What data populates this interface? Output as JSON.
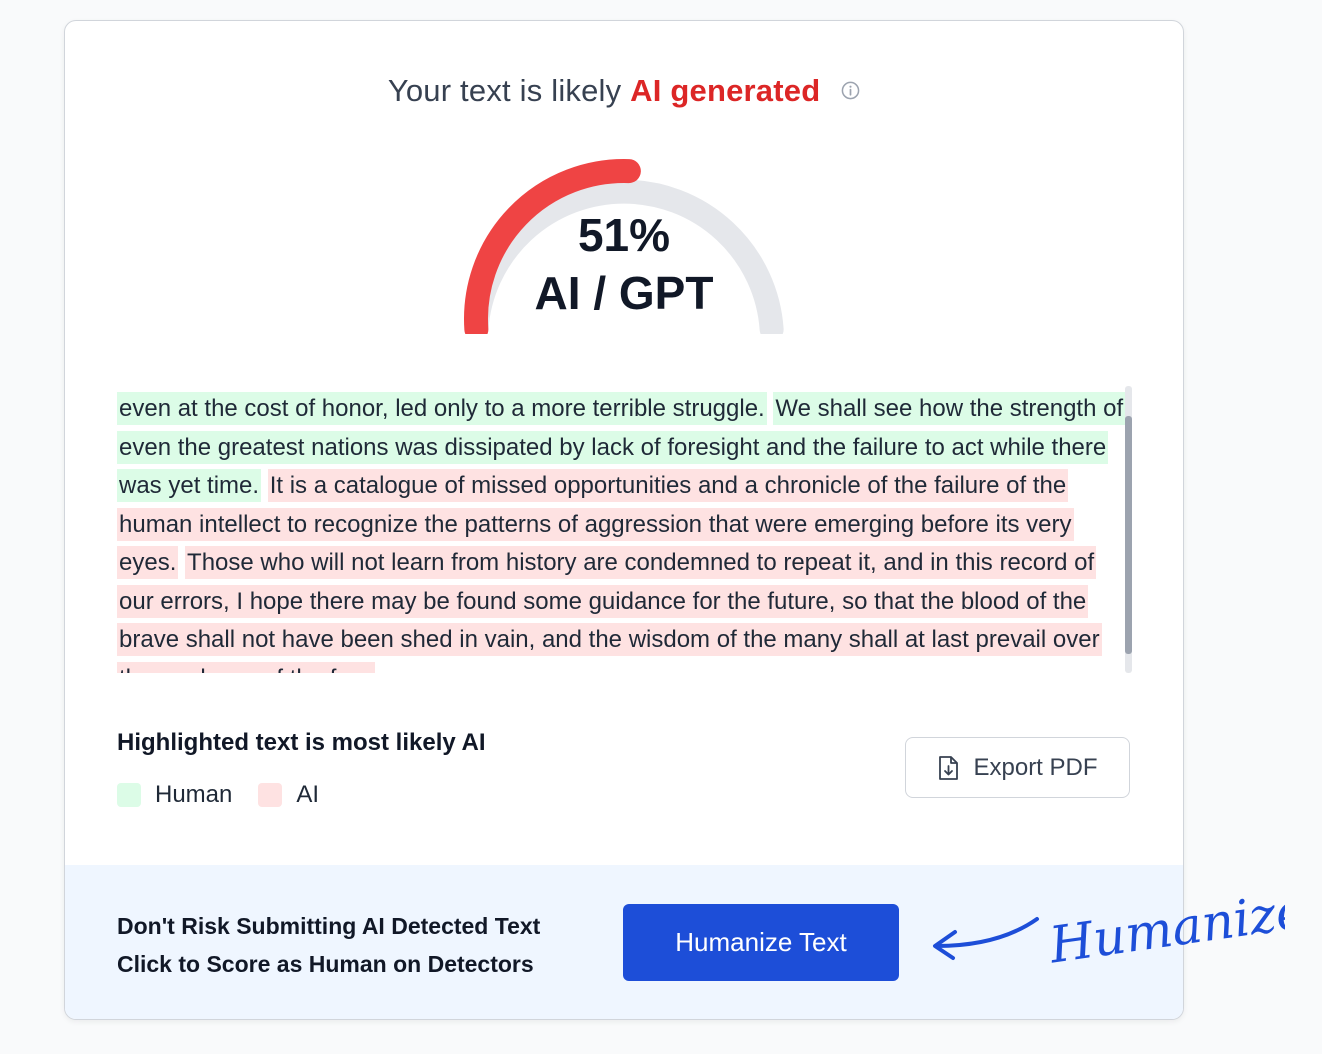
{
  "header": {
    "prefix": "Your text is likely",
    "verdict": "AI generated",
    "info_icon": "info-icon"
  },
  "gauge": {
    "value": 51,
    "percent_text": "51%",
    "label": "AI / GPT",
    "fill_color": "#ef4444",
    "track_color": "#e5e7eb"
  },
  "passage": {
    "segments": [
      {
        "type": "human",
        "text": "even at the cost of honor, led only to a more terrible struggle."
      },
      {
        "type": "human",
        "text": "We shall see how the strength of even the greatest nations was dissipated by lack of foresight and the failure to act while there was yet time."
      },
      {
        "type": "ai",
        "text": "It is a catalogue of missed opportunities and a chronicle of the failure of the human intellect to recognize the patterns of aggression that were emerging before its very eyes."
      },
      {
        "type": "ai",
        "text": "Those who will not learn from history are condemned to repeat it, and in this record of our errors, I hope there may be found some guidance for the future, so that the blood of the brave shall not have been shed in vain, and the wisdom of the many shall at last prevail over the madness of the few."
      }
    ]
  },
  "legend": {
    "title": "Highlighted text is most likely AI",
    "human_label": "Human",
    "ai_label": "AI",
    "human_color": "#dcfce7",
    "ai_color": "#fee2e2"
  },
  "export": {
    "label": "Export PDF",
    "icon": "file-download-icon"
  },
  "footer": {
    "line1": "Don't Risk Submitting AI Detected Text",
    "line2": "Click to Score as Human on Detectors",
    "button_label": "Humanize Text",
    "annotation": "Humanize!",
    "accent": "#1d4ed8"
  }
}
